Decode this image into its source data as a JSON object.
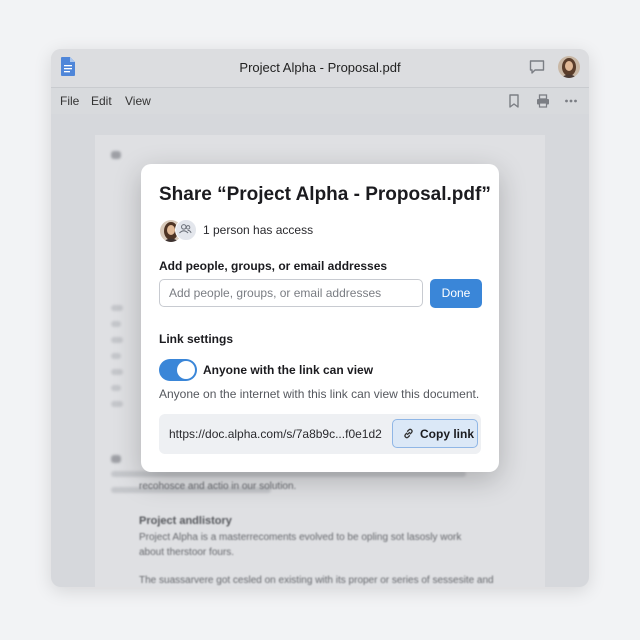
{
  "window": {
    "title": "Project Alpha - Proposal.pdf",
    "icons": [
      "document-app-icon",
      "comment-icon",
      "user-avatar",
      "bookmark-icon",
      "print-icon",
      "more-icon"
    ]
  },
  "menu": {
    "items": [
      "File",
      "Edit",
      "View"
    ]
  },
  "document_background": {
    "heading_1": "Project andlistory",
    "line_1": "Project Alpha is a masterrecoments evolved to be opling sot lasosly work",
    "line_2": "about therstoor fours.",
    "line_3": "The suassarvere got cesled on existing with its proper or series of sessesite and",
    "para_a": "recohosce and actio in our solution."
  },
  "dialog": {
    "title": "Share “Project Alpha - Proposal.pdf”",
    "access_text": "1 person has access",
    "add_label": "Add people, groups, or email addresses",
    "add_input_placeholder": "Add people, groups, or email addresses",
    "add_input_value": "",
    "done_label": "Done",
    "link_settings_label": "Link settings",
    "toggle_label": "Anyone with the link can view",
    "toggle_on": true,
    "link_description": "Anyone on the internet with this link can view this document.",
    "link_url": "https://doc.alpha.com/s/7a8b9c...f0e1d2",
    "copy_label": "Copy link"
  },
  "colors": {
    "accent": "#3a86d8",
    "copy_button_bg": "#dbe8f7",
    "dialog_bg": "#ffffff",
    "backdrop": "#d6d8dc"
  }
}
